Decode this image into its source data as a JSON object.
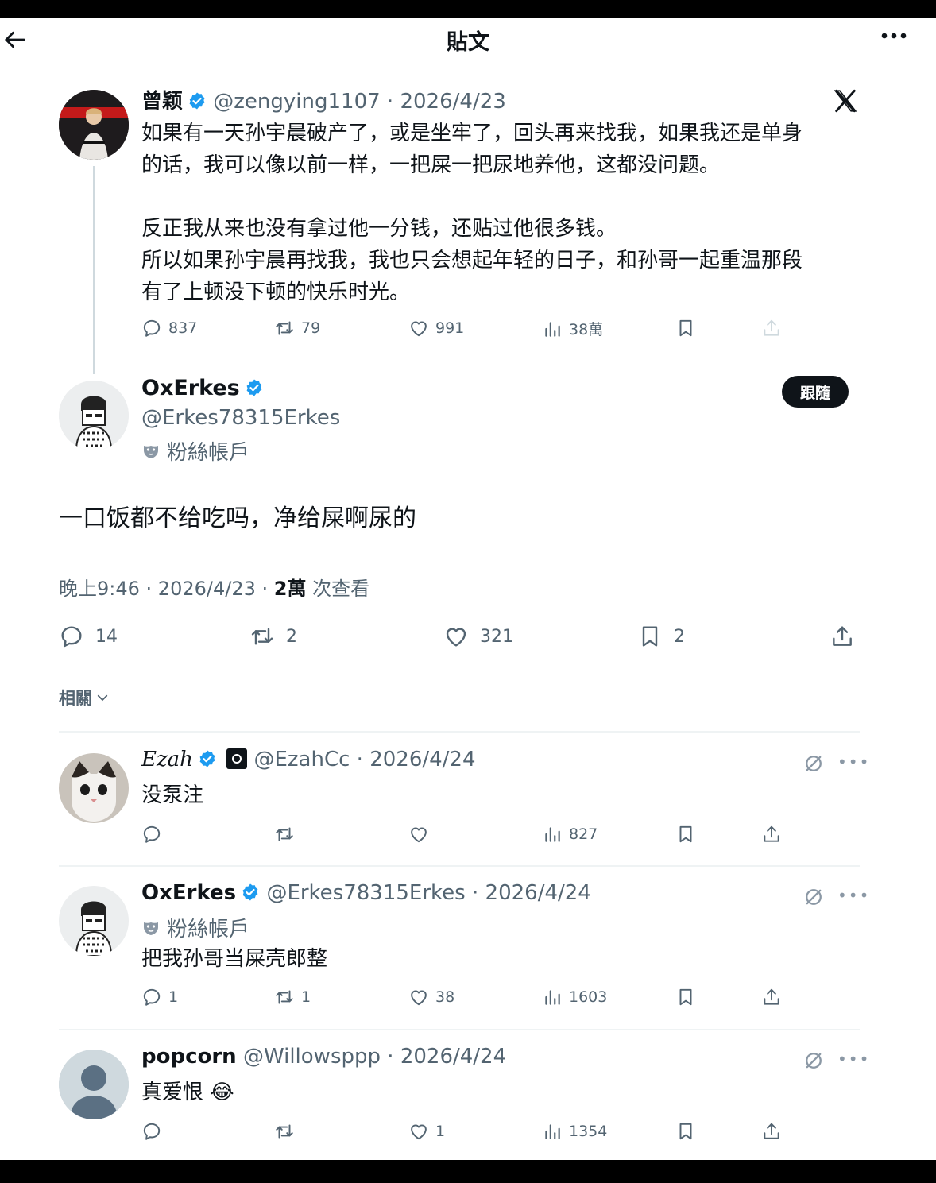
{
  "header": {
    "title": "貼文"
  },
  "quoted": {
    "name": "曾颖",
    "handle": "@zengying1107",
    "date": "2026/4/23",
    "text_lines": [
      "如果有一天孙宇晨破产了，或是坐牢了，回头再来找我，如果我还是单身",
      "的话，我可以像以前一样，一把屎一把尿地养他，这都没问题。",
      "",
      "反正我从来也没有拿过他一分钱，还贴过他很多钱。",
      "所以如果孙宇晨再找我，我也只会想起年轻的日子，和孙哥一起重温那段",
      "有了上顿没下顿的快乐时光。"
    ],
    "stats": {
      "replies": "837",
      "reposts": "79",
      "likes": "991",
      "views": "38萬"
    }
  },
  "main": {
    "name": "OxErkes",
    "handle": "@Erkes78315Erkes",
    "badge": "粉絲帳戶",
    "follow_label": "跟隨",
    "text": "一口饭都不给吃吗，净给屎啊尿的",
    "time": "晚上9:46",
    "date": "2026/4/23",
    "views_count": "2萬",
    "views_label": "次查看",
    "stats": {
      "replies": "14",
      "reposts": "2",
      "likes": "321",
      "bookmarks": "2"
    }
  },
  "related_label": "相關",
  "replies": [
    {
      "name": "Ezah",
      "handle": "@EzahCc",
      "date": "2026/4/24",
      "badge": "",
      "text": "没泵注",
      "stats": {
        "replies": "",
        "reposts": "",
        "likes": "",
        "views": "827"
      }
    },
    {
      "name": "OxErkes",
      "handle": "@Erkes78315Erkes",
      "date": "2026/4/24",
      "badge": "粉絲帳戶",
      "text": "把我孙哥当屎壳郎整",
      "stats": {
        "replies": "1",
        "reposts": "1",
        "likes": "38",
        "views": "1603"
      }
    },
    {
      "name": "popcorn",
      "handle": "@Willowsppp",
      "date": "2026/4/24",
      "badge": "",
      "text": "真爱恨 😂",
      "stats": {
        "replies": "",
        "reposts": "",
        "likes": "1",
        "views": "1354"
      }
    }
  ],
  "colors": {
    "accent": "#1d9bf0",
    "text": "#0f1419",
    "muted": "#536471"
  }
}
